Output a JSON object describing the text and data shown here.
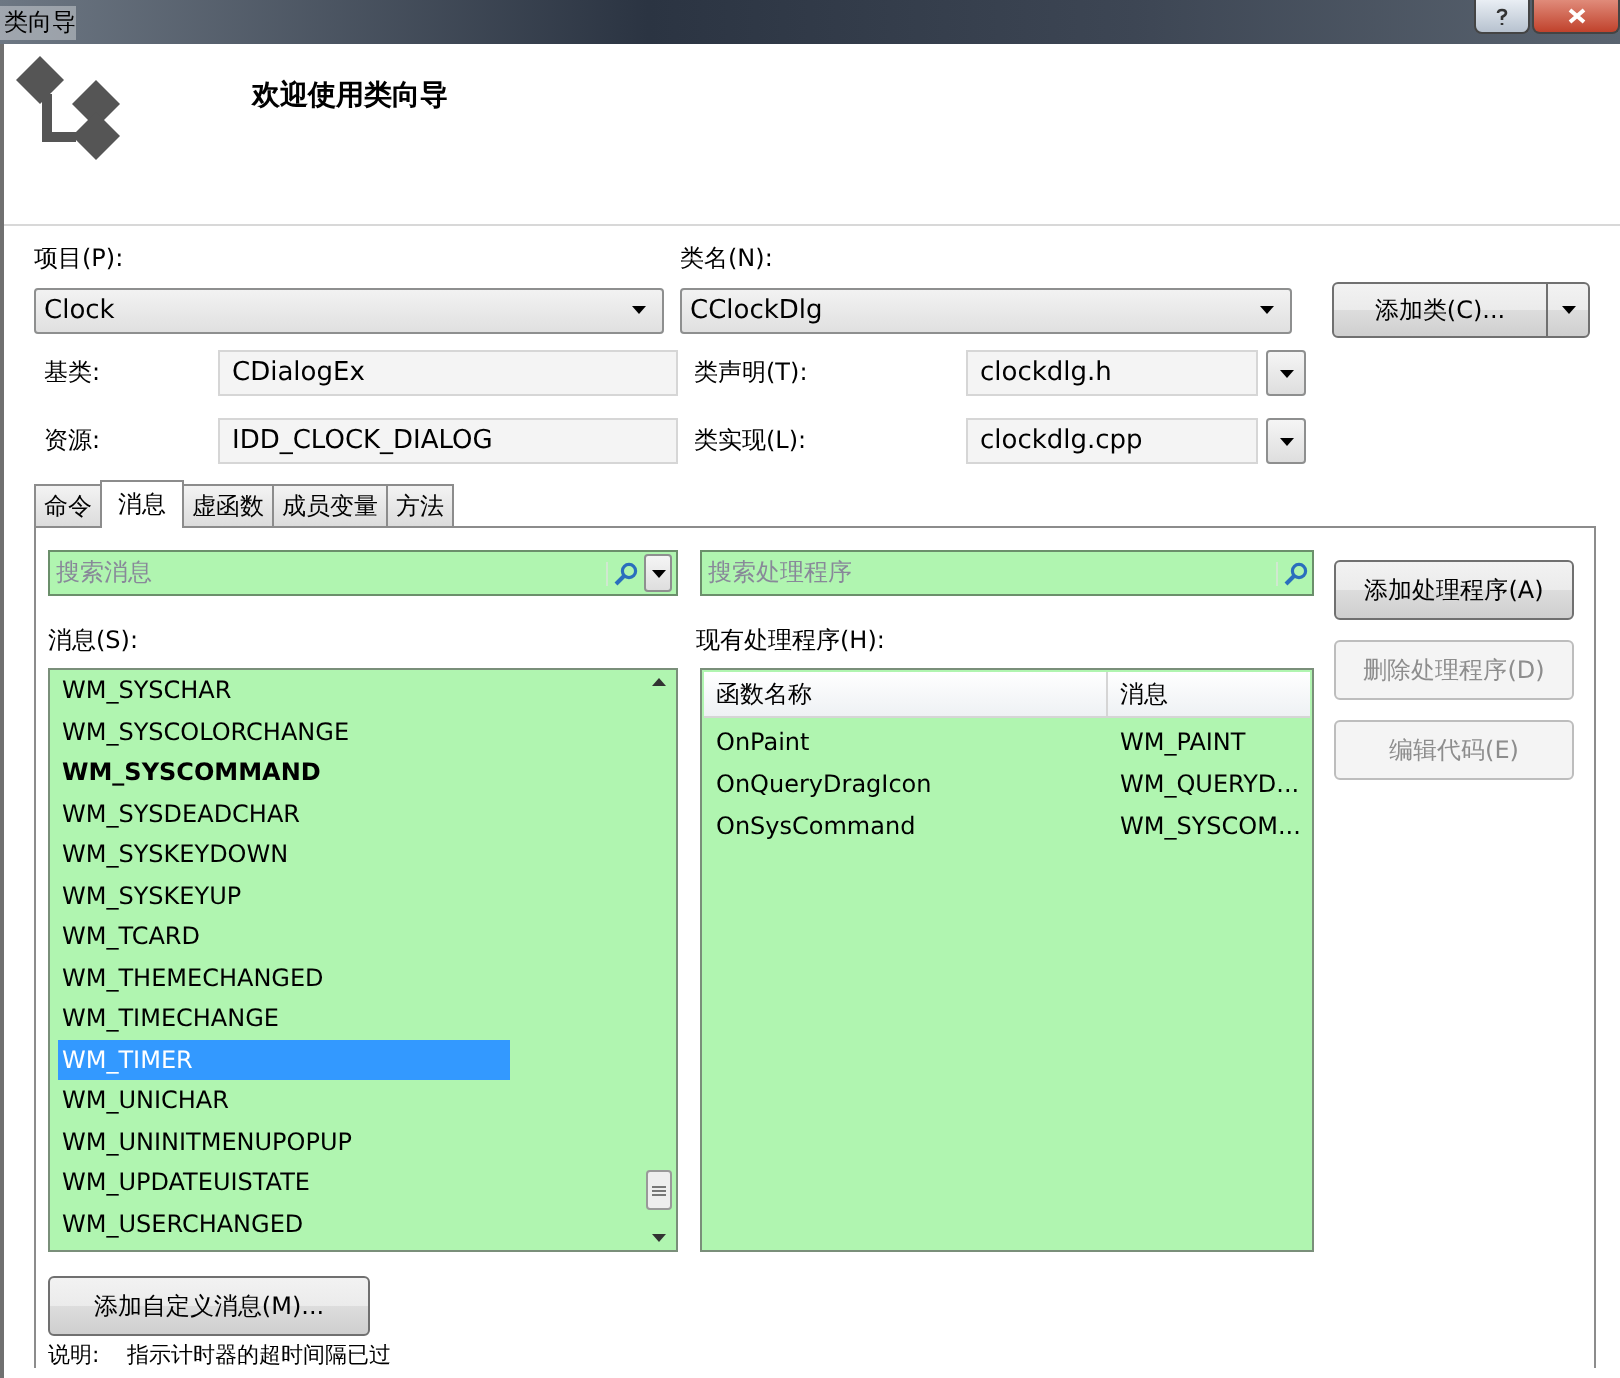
{
  "window": {
    "title": "类向导"
  },
  "header": {
    "title": "欢迎使用类向导"
  },
  "project": {
    "label": "项目(P):",
    "value": "Clock"
  },
  "class_name": {
    "label": "类名(N):",
    "value": "CClockDlg"
  },
  "add_class_button": "添加类(C)...",
  "base_class": {
    "label": "基类:",
    "value": "CDialogEx"
  },
  "class_declaration": {
    "label": "类声明(T):",
    "value": "clockdlg.h"
  },
  "resource": {
    "label": "资源:",
    "value": "IDD_CLOCK_DIALOG"
  },
  "class_implementation": {
    "label": "类实现(L):",
    "value": "clockdlg.cpp"
  },
  "tabs": [
    {
      "label": "命令",
      "selected": false
    },
    {
      "label": "消息",
      "selected": true
    },
    {
      "label": "虚函数",
      "selected": false
    },
    {
      "label": "成员变量",
      "selected": false
    },
    {
      "label": "方法",
      "selected": false
    }
  ],
  "messages": {
    "placeholder": "搜索消息",
    "label": "消息(S):",
    "items": [
      {
        "text": "WM_SYSCHAR",
        "bold": false,
        "selected": false
      },
      {
        "text": "WM_SYSCOLORCHANGE",
        "bold": false,
        "selected": false
      },
      {
        "text": "WM_SYSCOMMAND",
        "bold": true,
        "selected": false
      },
      {
        "text": "WM_SYSDEADCHAR",
        "bold": false,
        "selected": false
      },
      {
        "text": "WM_SYSKEYDOWN",
        "bold": false,
        "selected": false
      },
      {
        "text": "WM_SYSKEYUP",
        "bold": false,
        "selected": false
      },
      {
        "text": "WM_TCARD",
        "bold": false,
        "selected": false
      },
      {
        "text": "WM_THEMECHANGED",
        "bold": false,
        "selected": false
      },
      {
        "text": "WM_TIMECHANGE",
        "bold": false,
        "selected": false
      },
      {
        "text": "WM_TIMER",
        "bold": false,
        "selected": true
      },
      {
        "text": "WM_UNICHAR",
        "bold": false,
        "selected": false
      },
      {
        "text": "WM_UNINITMENUPOPUP",
        "bold": false,
        "selected": false
      },
      {
        "text": "WM_UPDATEUISTATE",
        "bold": false,
        "selected": false
      },
      {
        "text": "WM_USERCHANGED",
        "bold": false,
        "selected": false
      }
    ]
  },
  "handlers": {
    "placeholder": "搜索处理程序",
    "label": "现有处理程序(H):",
    "columns": [
      "函数名称",
      "消息"
    ],
    "rows": [
      [
        "OnPaint",
        "WM_PAINT"
      ],
      [
        "OnQueryDragIcon",
        "WM_QUERYD..."
      ],
      [
        "OnSysCommand",
        "WM_SYSCOM..."
      ]
    ]
  },
  "buttons": [
    {
      "label": "添加处理程序(A)",
      "disabled": false
    },
    {
      "label": "删除处理程序(D)",
      "disabled": true
    },
    {
      "label": "编辑代码(E)",
      "disabled": true
    }
  ],
  "add_custom_message_button": "添加自定义消息(M)...",
  "description": {
    "label": "说明:",
    "text": "指示计时器的超时间隔已过"
  }
}
